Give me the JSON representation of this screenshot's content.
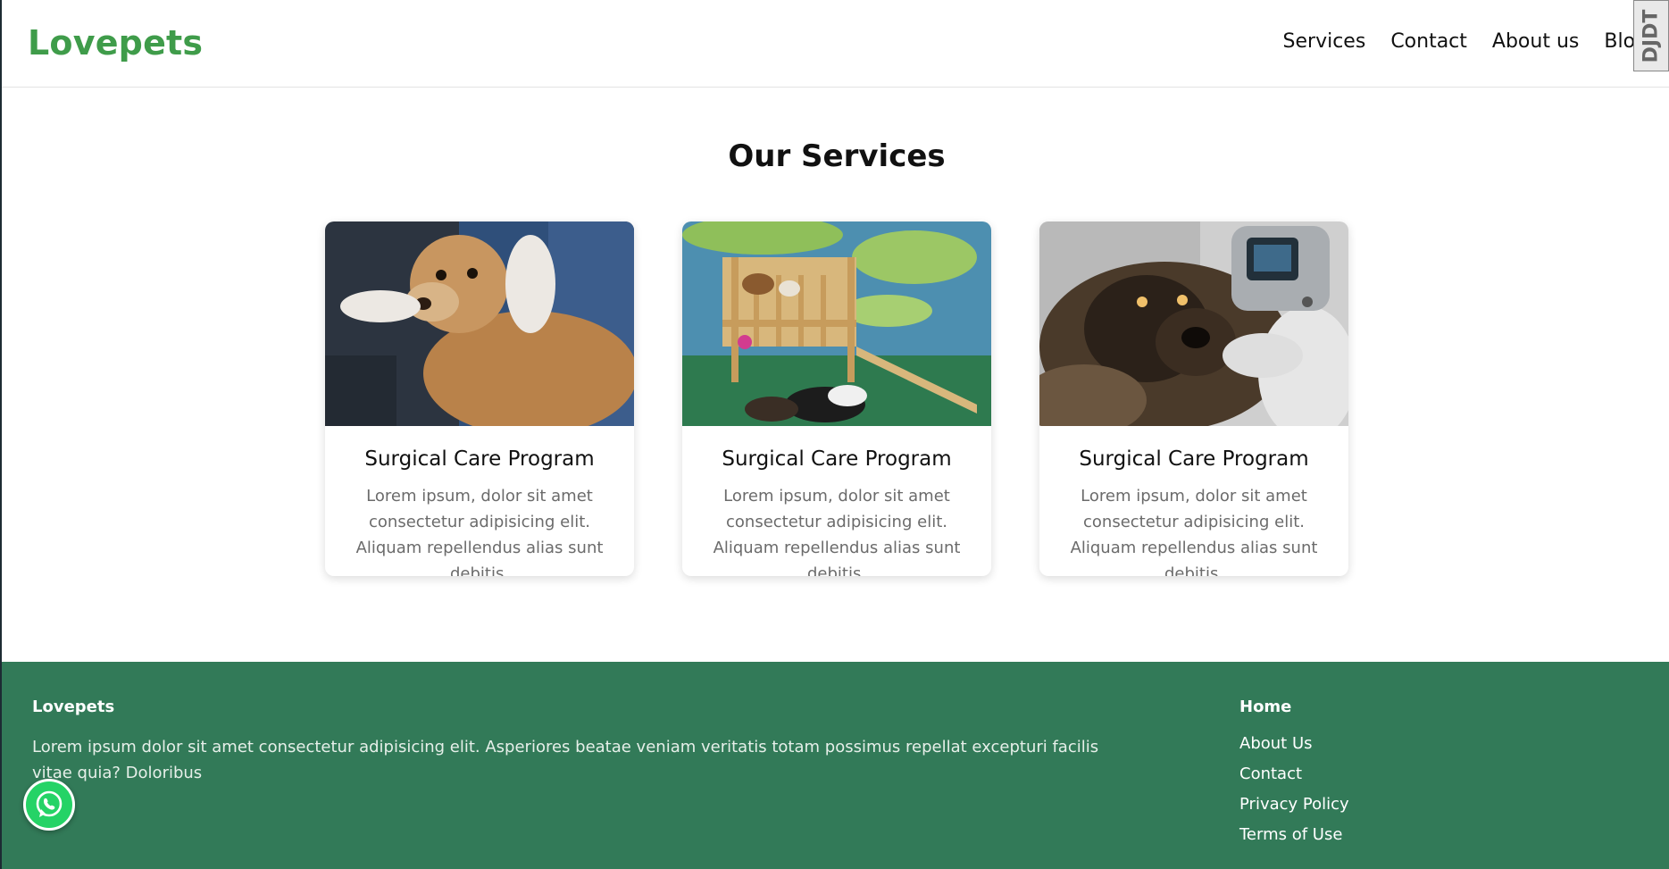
{
  "header": {
    "logo": "Lovepets",
    "nav": [
      {
        "label": "Services"
      },
      {
        "label": "Contact"
      },
      {
        "label": "About us"
      },
      {
        "label": "Blog"
      }
    ],
    "dev_badge": "DJDT"
  },
  "services": {
    "title": "Our Services",
    "cards": [
      {
        "title": "Surgical Care Program",
        "text": "Lorem ipsum, dolor sit amet consectetur adipisicing elit. Aliquam repellendus alias sunt debitis.",
        "image": "vet-examining-dog-photo"
      },
      {
        "title": "Surgical Care Program",
        "text": "Lorem ipsum, dolor sit amet consectetur adipisicing elit. Aliquam repellendus alias sunt debitis.",
        "image": "dog-daycare-playroom-photo"
      },
      {
        "title": "Surgical Care Program",
        "text": "Lorem ipsum, dolor sit amet consectetur adipisicing elit. Aliquam repellendus alias sunt debitis.",
        "image": "dog-temperature-check-photo"
      }
    ]
  },
  "footer": {
    "brand": "Lovepets",
    "text": "Lorem ipsum dolor sit amet consectetur adipisicing elit. Asperiores beatae veniam veritatis totam possimus repellat excepturi facilis vitae quia? Doloribus",
    "links_heading": "Home",
    "links": [
      "About Us",
      "Contact",
      "Privacy Policy",
      "Terms of Use"
    ]
  },
  "colors": {
    "brand_green": "#3f9c4a",
    "footer_bg": "#327a58",
    "whatsapp": "#25d366"
  },
  "icons": {
    "chat": "whatsapp-icon"
  }
}
